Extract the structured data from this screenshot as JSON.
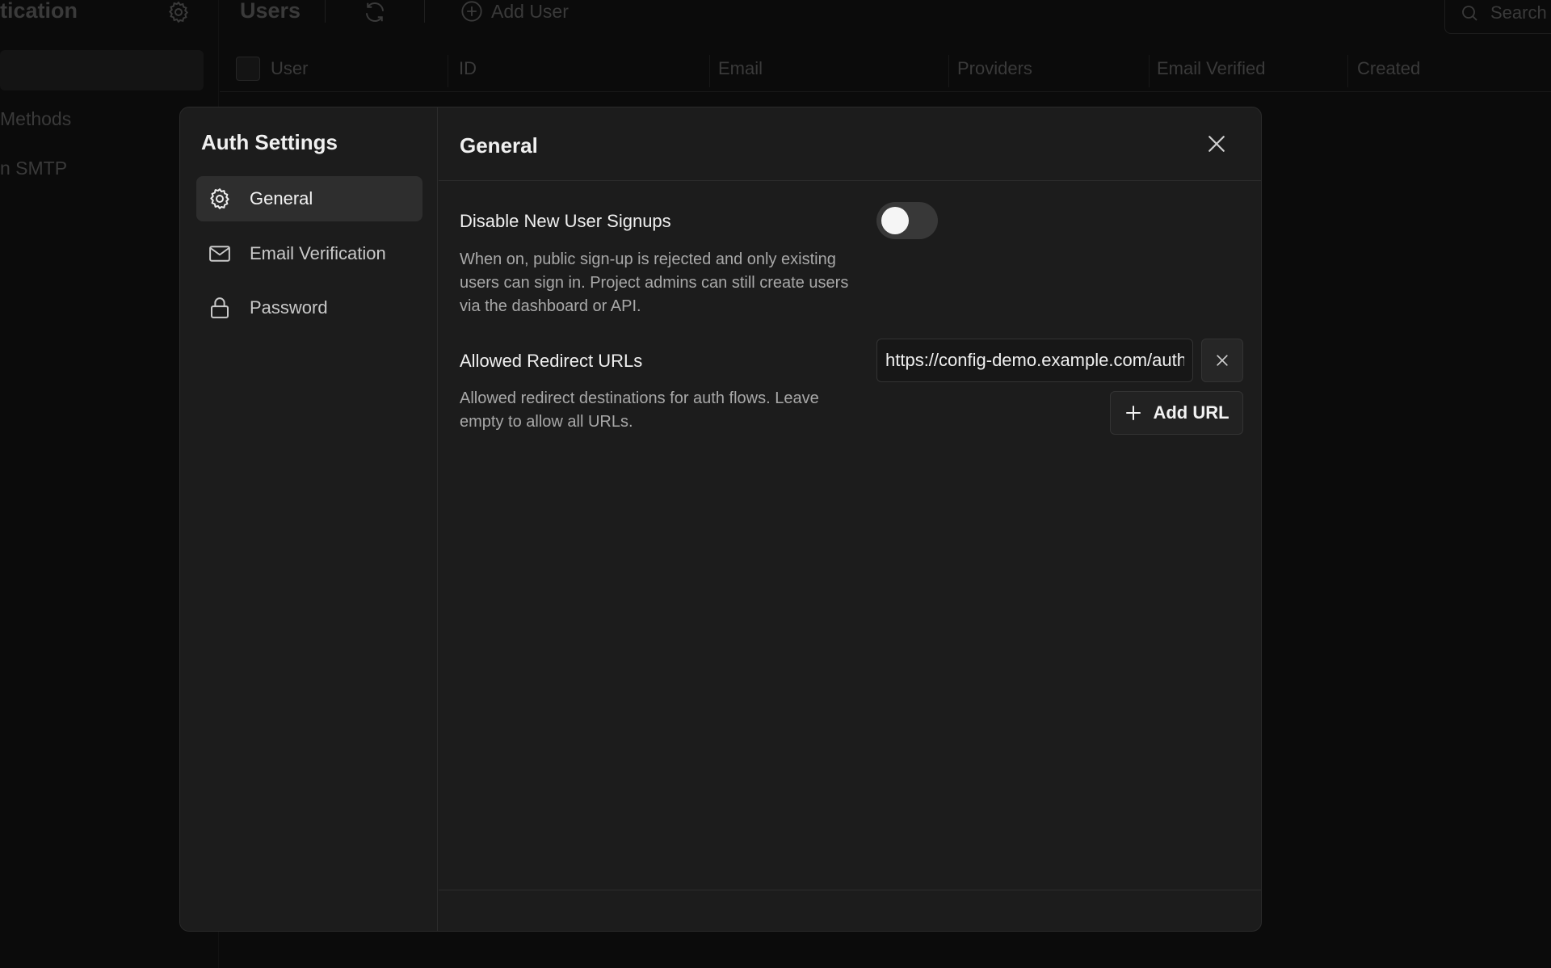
{
  "background": {
    "app_title": "tication",
    "users_title": "Users",
    "add_user_label": "Add User",
    "search_label": "Search",
    "sidebar_items": [
      "Methods",
      "n SMTP"
    ],
    "table_columns": [
      "User",
      "ID",
      "Email",
      "Providers",
      "Email Verified",
      "Created"
    ]
  },
  "modal": {
    "nav": {
      "title": "Auth Settings",
      "items": [
        {
          "label": "General",
          "icon": "gear-icon",
          "active": true
        },
        {
          "label": "Email Verification",
          "icon": "mail-icon",
          "active": false
        },
        {
          "label": "Password",
          "icon": "lock-icon",
          "active": false
        }
      ]
    },
    "main": {
      "title": "General",
      "signups": {
        "label": "Disable New User Signups",
        "description": "When on, public sign-up is rejected and only existing users can sign in. Project admins can still create users via the dashboard or API.",
        "enabled": false
      },
      "redirects": {
        "label": "Allowed Redirect URLs",
        "description": "Allowed redirect destinations for auth flows. Leave empty to allow all URLs.",
        "url_value": "https://config-demo.example.com/auth/callback",
        "add_label": "Add URL"
      }
    }
  },
  "colors": {
    "backdrop": "#000000",
    "modal_bg": "#1c1c1c",
    "active_nav": "#2e2e2e",
    "toggle_off": "#383838"
  }
}
